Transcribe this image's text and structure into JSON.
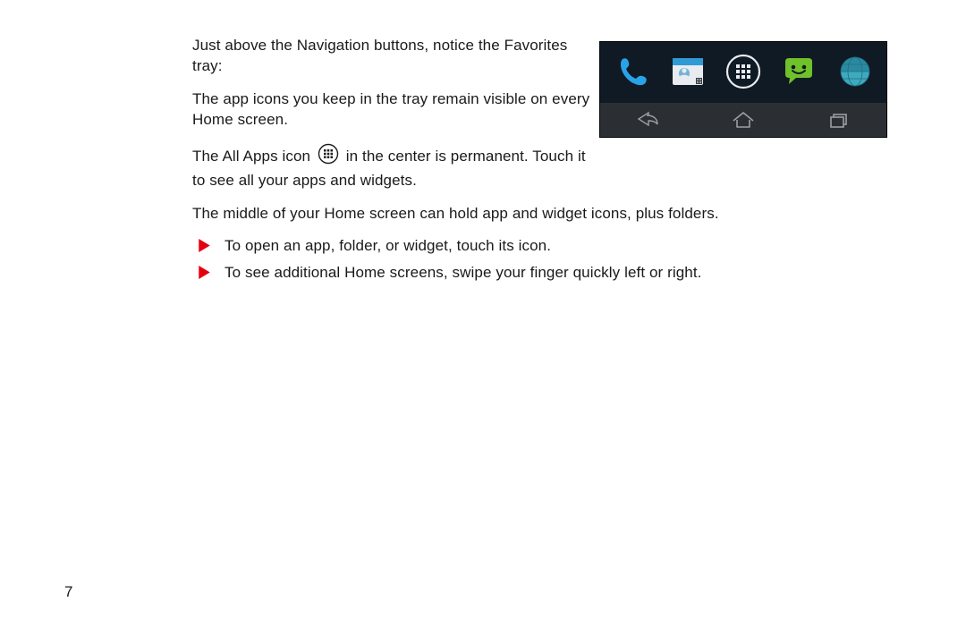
{
  "paragraphs": {
    "p1": "Just above the Navigation buttons, notice the Favorites tray:",
    "p2": "The app icons you keep in the tray remain visible on every Home screen.",
    "p3a": "The All Apps icon",
    "p3b": "in the center is permanent. Touch it to see all your apps and widgets.",
    "p4": "The middle of your Home screen can hold app and widget icons, plus folders."
  },
  "bullets": [
    "To open an app, folder, or widget, touch its icon.",
    "To see additional Home screens, swipe your finger quickly left or right."
  ],
  "page_number": "7",
  "icons": {
    "all_apps": "all-apps-icon",
    "phone": "phone-icon",
    "contacts": "contacts-icon",
    "messaging": "messaging-icon",
    "browser": "browser-icon",
    "nav_back": "back-icon",
    "nav_home": "home-icon",
    "nav_recents": "recents-icon",
    "bullet": "play-arrow-icon"
  },
  "colors": {
    "bullet_red": "#e6000f",
    "phone_blue": "#29a3e6",
    "msg_green": "#6fc229",
    "browser_teal": "#3fa9be",
    "nav_gray": "#9aa0a5"
  }
}
